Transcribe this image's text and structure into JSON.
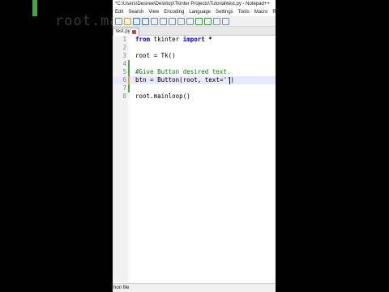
{
  "background": {
    "code_fragment": "root.ma"
  },
  "window": {
    "title": "*C:\\Users\\Desiree\\Desktop\\Tkinter Projects\\Tutorial\\test.py - Notepad++",
    "menus": [
      "Edit",
      "Search",
      "View",
      "Encoding",
      "Language",
      "Settings",
      "Tools",
      "Macro",
      "Ru"
    ],
    "tab_label": "test.py",
    "status_text": "hon file"
  },
  "editor": {
    "line_numbers": [
      "1",
      "2",
      "3",
      "4",
      "5",
      "6",
      "7",
      "8"
    ],
    "lines": {
      "l1": {
        "kw1": "from",
        "mod": " tkinter ",
        "kw2": "import",
        "star": " *"
      },
      "l3": {
        "text": "root = Tk()"
      },
      "l5": {
        "comment": "#Give Button desired text."
      },
      "l6": {
        "pre": "btn = Button(root",
        "mid": ", text=",
        "str": "\"\"",
        "close": ")"
      },
      "l8": {
        "text": "root.mainloop()"
      }
    }
  },
  "colors": {
    "keyword": "#0000ff",
    "comment": "#008000",
    "string": "#808080",
    "current_line": "#e8e8ff",
    "change_marker_saved": "#3fb33f",
    "change_marker_unsaved": "#f0a030"
  },
  "icons": [
    "new-file-icon",
    "open-icon",
    "save-icon",
    "save-all-icon",
    "close-icon",
    "print-icon",
    "cut-icon",
    "copy-icon",
    "paste-icon",
    "undo-icon",
    "redo-icon",
    "find-icon",
    "zoom-icon"
  ]
}
